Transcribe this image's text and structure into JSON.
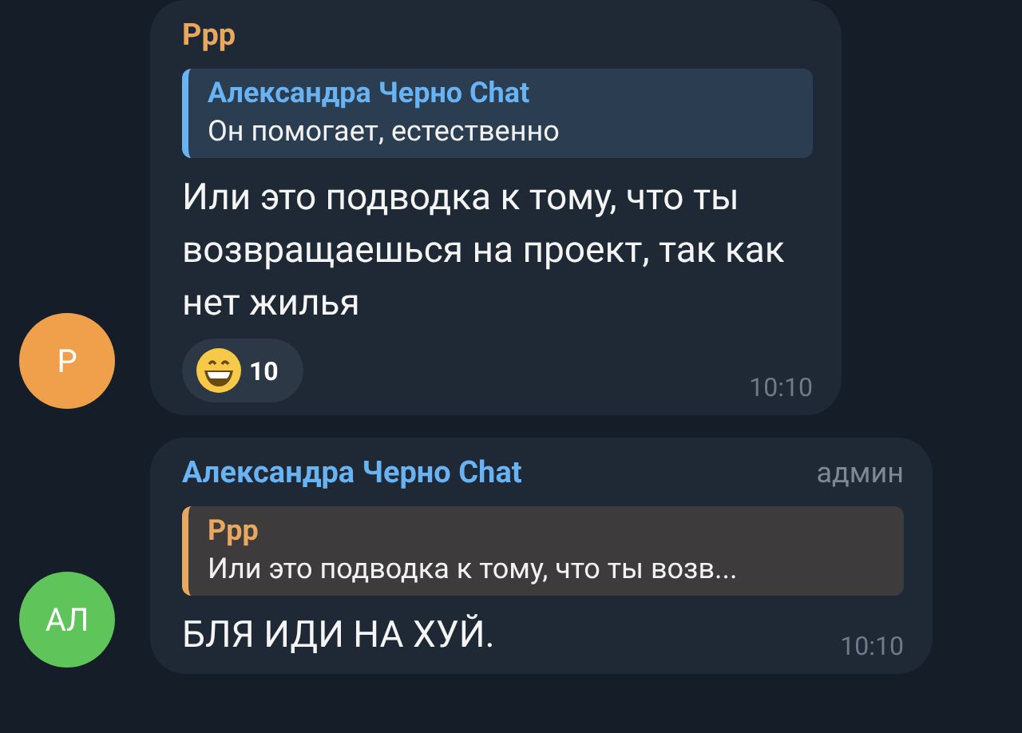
{
  "messages": [
    {
      "sender": {
        "name": "Ррр",
        "color": "#e8a860"
      },
      "avatar": {
        "initials": "Р",
        "color": "#f0a04b"
      },
      "reply": {
        "name": "Александра Черно Chat",
        "color": "#6ab3f3",
        "text": "Он помогает, естественно"
      },
      "text": "Или это подводка к тому, что ты возвращаешься на проект, так как нет жилья",
      "reactions": [
        {
          "count": "10"
        }
      ],
      "time": "10:10"
    },
    {
      "sender": {
        "name": "Александра Черно Chat",
        "color": "#6ab3f3"
      },
      "badge": "админ",
      "avatar": {
        "initials": "АЛ",
        "color": "#5fc45a"
      },
      "reply": {
        "name": "Ррр",
        "color": "#e8a860",
        "text": "Или это подводка к тому, что ты возв..."
      },
      "text": "БЛЯ ИДИ НА ХУЙ.",
      "time": "10:10"
    }
  ]
}
